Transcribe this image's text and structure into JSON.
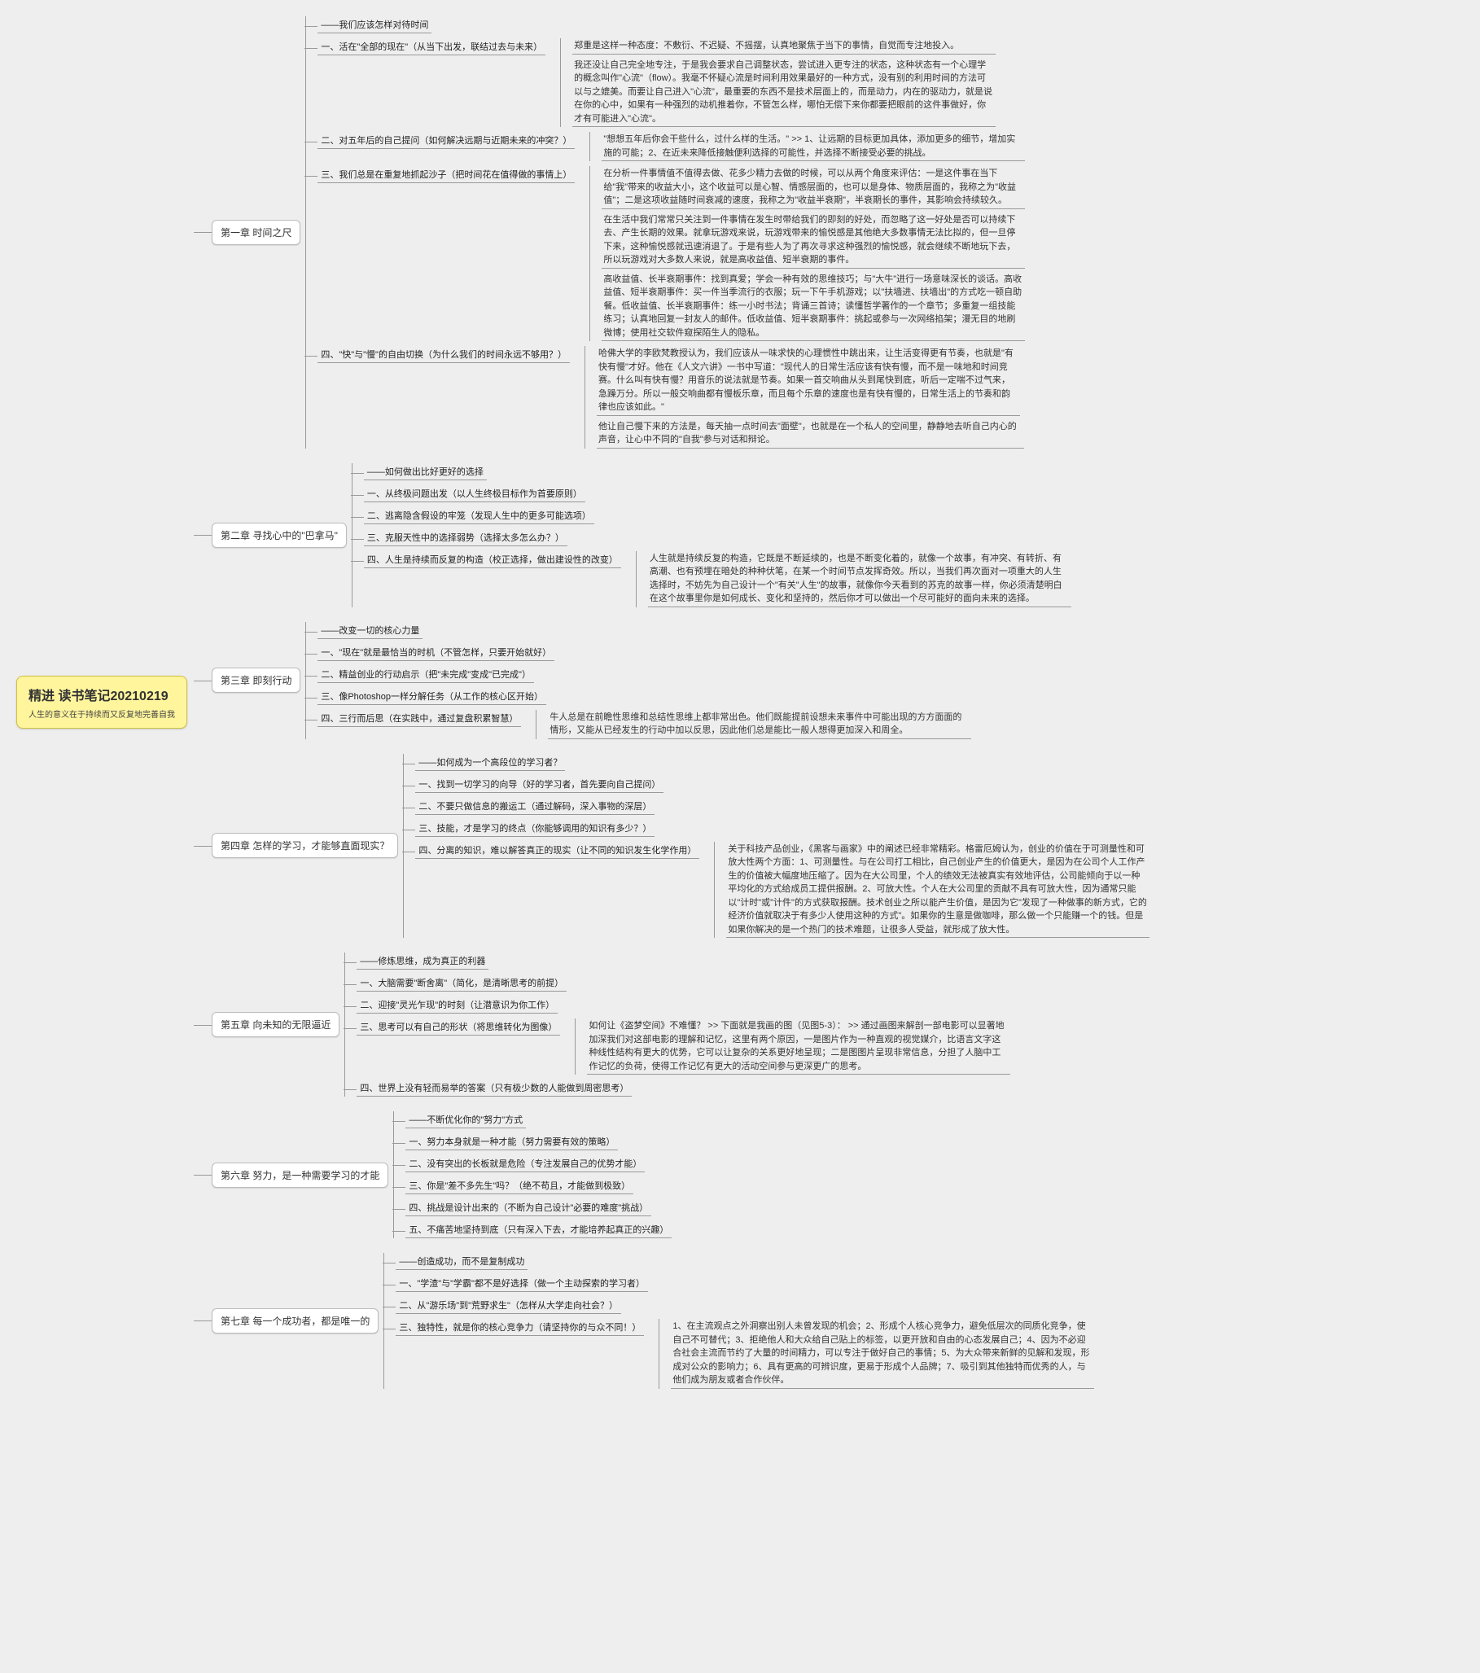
{
  "root": {
    "title": "精进 读书笔记20210219",
    "subtitle": "人生的意义在于持续而又反复地完善自我"
  },
  "ch1": {
    "title": "第一章 时间之尺",
    "intro": "——我们应该怎样对待时间",
    "n1": "一、活在\"全部的现在\"（从当下出发，联结过去与未来）",
    "n1a": "郑重是这样一种态度：不敷衍、不迟疑、不摇摆，认真地聚焦于当下的事情，自觉而专注地投入。",
    "n1b": "我还没让自己完全地专注，于是我会要求自己调整状态，尝试进入更专注的状态，这种状态有一个心理学的概念叫作\"心流\"（flow）。我毫不怀疑心流是时间利用效果最好的一种方式，没有别的利用时间的方法可以与之媲美。而要让自己进入\"心流\"，最重要的东西不是技术层面上的，而是动力，内在的驱动力，就是说在你的心中，如果有一种强烈的动机推着你，不管怎么样，哪怕无偿下来你都要把眼前的这件事做好，你才有可能进入\"心流\"。",
    "n2": "二、对五年后的自己提问（如何解决远期与近期未来的冲突？）",
    "n2a": "\"想想五年后你会干些什么，过什么样的生活。\" >> 1、让远期的目标更加具体，添加更多的细节，增加实施的可能；2、在近未来降低接触便利选择的可能性，并选择不断接受必要的挑战。",
    "n3": "三、我们总是在重复地抓起沙子（把时间花在值得做的事情上）",
    "n3a": "在分析一件事情值不值得去做、花多少精力去做的时候，可以从两个角度来评估：一是这件事在当下给\"我\"带来的收益大小，这个收益可以是心智、情感层面的，也可以是身体、物质层面的，我称之为\"收益值\"；二是这项收益随时间衰减的速度，我称之为\"收益半衰期\"，半衰期长的事件，其影响会持续较久。",
    "n3b": "在生活中我们常常只关注到一件事情在发生时带给我们的即刻的好处，而忽略了这一好处是否可以持续下去、产生长期的效果。就拿玩游戏来说，玩游戏带来的愉悦感是其他绝大多数事情无法比拟的，但一旦停下来，这种愉悦感就迅速消退了。于是有些人为了再次寻求这种强烈的愉悦感，就会继续不断地玩下去，所以玩游戏对大多数人来说，就是高收益值、短半衰期的事件。",
    "n3c": "高收益值、长半衰期事件：找到真爱；学会一种有效的思维技巧；与\"大牛\"进行一场意味深长的谈话。高收益值、短半衰期事件：买一件当季流行的衣服；玩一下午手机游戏；以\"扶墙进、扶墙出\"的方式吃一顿自助餐。低收益值、长半衰期事件：练一小时书法；背诵三首诗；读懂哲学著作的一个章节；多重复一组技能练习；认真地回复一封友人的邮件。低收益值、短半衰期事件：挑起或参与一次网络掐架；漫无目的地刷微博；使用社交软件窥探陌生人的隐私。",
    "n4": "四、\"快\"与\"慢\"的自由切换（为什么我们的时间永远不够用？）",
    "n4a": "哈佛大学的李欧梵教授认为，我们应该从一味求快的心理惯性中跳出来，让生活变得更有节奏，也就是\"有快有慢\"才好。他在《人文六讲》一书中写道：\"现代人的日常生活应该有快有慢，而不是一味地和时间竞赛。什么叫有快有慢？用音乐的说法就是节奏。如果一首交响曲从头到尾快到底，听后一定喘不过气来，急躁万分。所以一般交响曲都有慢板乐章，而且每个乐章的速度也是有快有慢的，日常生活上的节奏和韵律也应该如此。\"",
    "n4b": "他让自己慢下来的方法是，每天抽一点时间去\"面壁\"，也就是在一个私人的空间里，静静地去听自己内心的声音，让心中不同的\"自我\"参与对话和辩论。"
  },
  "ch2": {
    "title": "第二章 寻找心中的\"巴拿马\"",
    "intro": "——如何做出比好更好的选择",
    "n1": "一、从终极问题出发（以人生终极目标作为首要原则）",
    "n2": "二、逃离隐含假设的牢笼（发现人生中的更多可能选项）",
    "n3": "三、克服天性中的选择弱势（选择太多怎么办？）",
    "n4": "四、人生是持续而反复的构造（校正选择，做出建设性的改变）",
    "n4a": "人生就是持续反复的构造，它既是不断延续的，也是不断变化着的，就像一个故事，有冲突、有转折、有高潮、也有预埋在暗处的种种伏笔，在某一个时间节点发挥奇效。所以，当我们再次面对一项重大的人生选择时，不妨先为自己设计一个\"有关\"人生\"的故事，就像你今天看到的苏克的故事一样，你必须清楚明白在这个故事里你是如何成长、变化和坚持的，然后你才可以做出一个尽可能好的面向未来的选择。"
  },
  "ch3": {
    "title": "第三章 即刻行动",
    "intro": "——改变一切的核心力量",
    "n1": "一、\"现在\"就是最恰当的时机（不管怎样，只要开始就好）",
    "n2": "二、精益创业的行动启示（把\"未完成\"变成\"已完成\"）",
    "n3": "三、像Photoshop一样分解任务（从工作的核心区开始）",
    "n4": "四、三行而后思（在实践中，通过复盘积累智慧）",
    "n4a": "牛人总是在前瞻性思维和总结性思维上都非常出色。他们既能提前设想未来事件中可能出现的方方面面的情形，又能从已经发生的行动中加以反思，因此他们总是能比一般人想得更加深入和周全。"
  },
  "ch4": {
    "title": "第四章 怎样的学习，才能够直面现实？",
    "intro": "——如何成为一个高段位的学习者？",
    "n1": "一、找到一切学习的向导（好的学习者，首先要向自己提问）",
    "n2": "二、不要只做信息的搬运工（通过解码，深入事物的深层）",
    "n3": "三、技能，才是学习的终点（你能够调用的知识有多少？）",
    "n4": "四、分离的知识，难以解答真正的现实（让不同的知识发生化学作用）",
    "n4a": "关于科技产品创业，《黑客与画家》中的阐述已经非常精彩。格雷厄姆认为，创业的价值在于可测量性和可放大性两个方面：1、可测量性。与在公司打工相比，自己创业产生的价值更大，是因为在公司个人工作产生的价值被大幅度地压缩了。因为在大公司里，个人的绩效无法被真实有效地评估，公司能倾向于以一种平均化的方式给成员工提供报酬。2、可放大性。个人在大公司里的贡献不具有可放大性，因为通常只能以\"计时\"或\"计件\"的方式获取报酬。技术创业之所以能产生价值，是因为它\"发现了一种做事的新方式，它的经济价值就取决于有多少人使用这种的方式\"。如果你的生意是做咖啡，那么做一个只能赚一个的钱。但是如果你解决的是一个热门的技术难题，让很多人受益，就形成了放大性。"
  },
  "ch5": {
    "title": "第五章 向未知的无限逼近",
    "intro": "——修炼思维，成为真正的利器",
    "n1": "一、大脑需要\"断舍离\"（简化，是清晰思考的前提）",
    "n2": "二、迎接\"灵光乍现\"的时刻（让潜意识为你工作）",
    "n3": "三、思考可以有自己的形状（将思维转化为图像）",
    "n3a": "如何让《盗梦空间》不难懂？ >> 下面就是我画的图（见图5-3）： >> 通过画图来解剖一部电影可以显著地加深我们对这部电影的理解和记忆，这里有两个原因，一是图片作为一种直观的视觉媒介，比语言文字这种线性结构有更大的优势，它可以让复杂的关系更好地呈现；二是图图片呈现非常信息，分担了人脑中工作记忆的负荷，使得工作记忆有更大的活动空间参与更深更广的思考。",
    "n4": "四、世界上没有轻而易举的答案（只有极少数的人能做到周密思考）"
  },
  "ch6": {
    "title": "第六章 努力，是一种需要学习的才能",
    "intro": "——不断优化你的\"努力\"方式",
    "n1": "一、努力本身就是一种才能（努力需要有效的策略）",
    "n2": "二、没有突出的长板就是危险（专注发展自己的优势才能）",
    "n3": "三、你是\"差不多先生\"吗？（绝不苟且，才能做到极致）",
    "n4": "四、挑战是设计出来的（不断为自己设计\"必要的难度\"挑战）",
    "n5": "五、不痛苦地坚持到底（只有深入下去，才能培养起真正的兴趣）"
  },
  "ch7": {
    "title": "第七章 每一个成功者，都是唯一的",
    "intro": "——创造成功，而不是复制成功",
    "n1": "一、\"学渣\"与\"学霸\"都不是好选择（做一个主动探索的学习者）",
    "n2": "二、从\"游乐场\"到\"荒野求生\"（怎样从大学走向社会？）",
    "n3": "三、独特性，就是你的核心竞争力（请坚持你的与众不同！）",
    "n3a": "1、在主流观点之外洞察出别人未曾发现的机会；2、形成个人核心竞争力，避免低层次的同质化竞争，使自己不可替代；3、拒绝他人和大众给自己贴上的标签，以更开放和自由的心态发展自己；4、因为不必迎合社会主流而节约了大量的时间精力，可以专注于做好自己的事情；5、为大众带来新鲜的见解和发现，形成对公众的影响力；6、具有更高的可辨识度，更易于形成个人品牌；7、吸引到其他独特而优秀的人，与他们成为朋友或者合作伙伴。"
  }
}
